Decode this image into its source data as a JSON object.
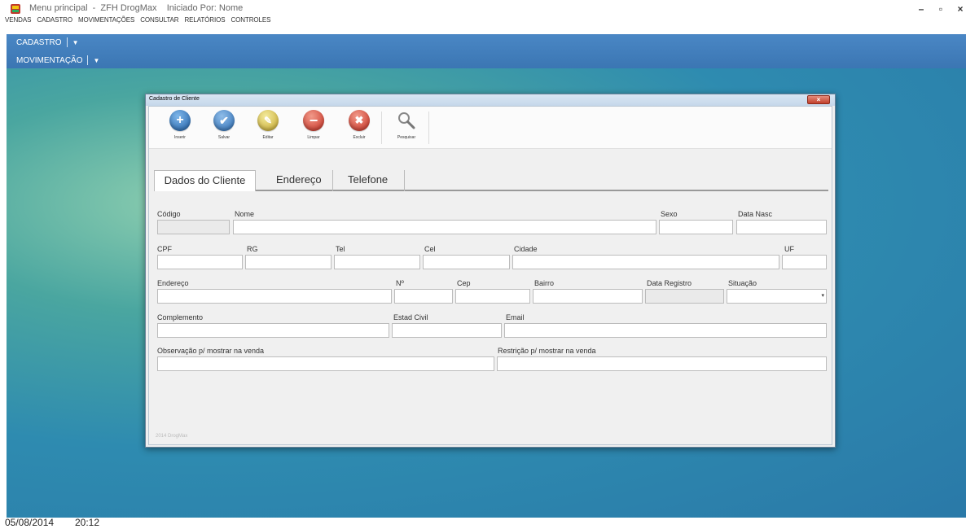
{
  "titlebar": {
    "title": "Menu principal  -  ZFH DrogMax    Iniciado Por: Nome",
    "menu": [
      "VENDAS",
      "CADASTRO",
      "MOVIMENTAÇÕES",
      "CONSULTAR",
      "RELATÓRIOS",
      "CONTROLES"
    ],
    "minimize": "–",
    "maximize": "▫",
    "close": "×"
  },
  "ribbon": {
    "cadastro": "CADASTRO",
    "movimentacao": "MOVIMENTAÇÃO",
    "dropdown": "▼"
  },
  "dialog": {
    "title": "Cadastro de Cliente",
    "close": "×",
    "toolbar": {
      "inserir": "Inserir",
      "salvar": "Salvar",
      "editar": "Editar",
      "limpar": "Limpar",
      "excluir": "Excluir",
      "pesquisar": "Pesquisar"
    },
    "tabs": [
      "Dados do Cliente",
      "Endereço",
      "Telefone"
    ],
    "labels": {
      "codigo": "Código",
      "nome": "Nome",
      "sexo": "Sexo",
      "data_nasc": "Data Nasc",
      "cpf": "CPF",
      "rg": "RG",
      "tel": "Tel",
      "cel": "Cel",
      "cidade": "Cidade",
      "uf": "UF",
      "endereco": "Endereço",
      "numero": "Nº",
      "cep": "Cep",
      "bairro": "Bairro",
      "data_registro": "Data Registro",
      "situacao": "Situação",
      "complemento": "Complemento",
      "estad_civil": "Estad Civil",
      "email": "Email",
      "observacao": "Observação p/ mostrar na venda",
      "restricao": "Restrição p/ mostrar na venda"
    },
    "footer": "2014  DrogMax"
  },
  "status": {
    "date": "05/08/2014",
    "time": "20:12"
  }
}
